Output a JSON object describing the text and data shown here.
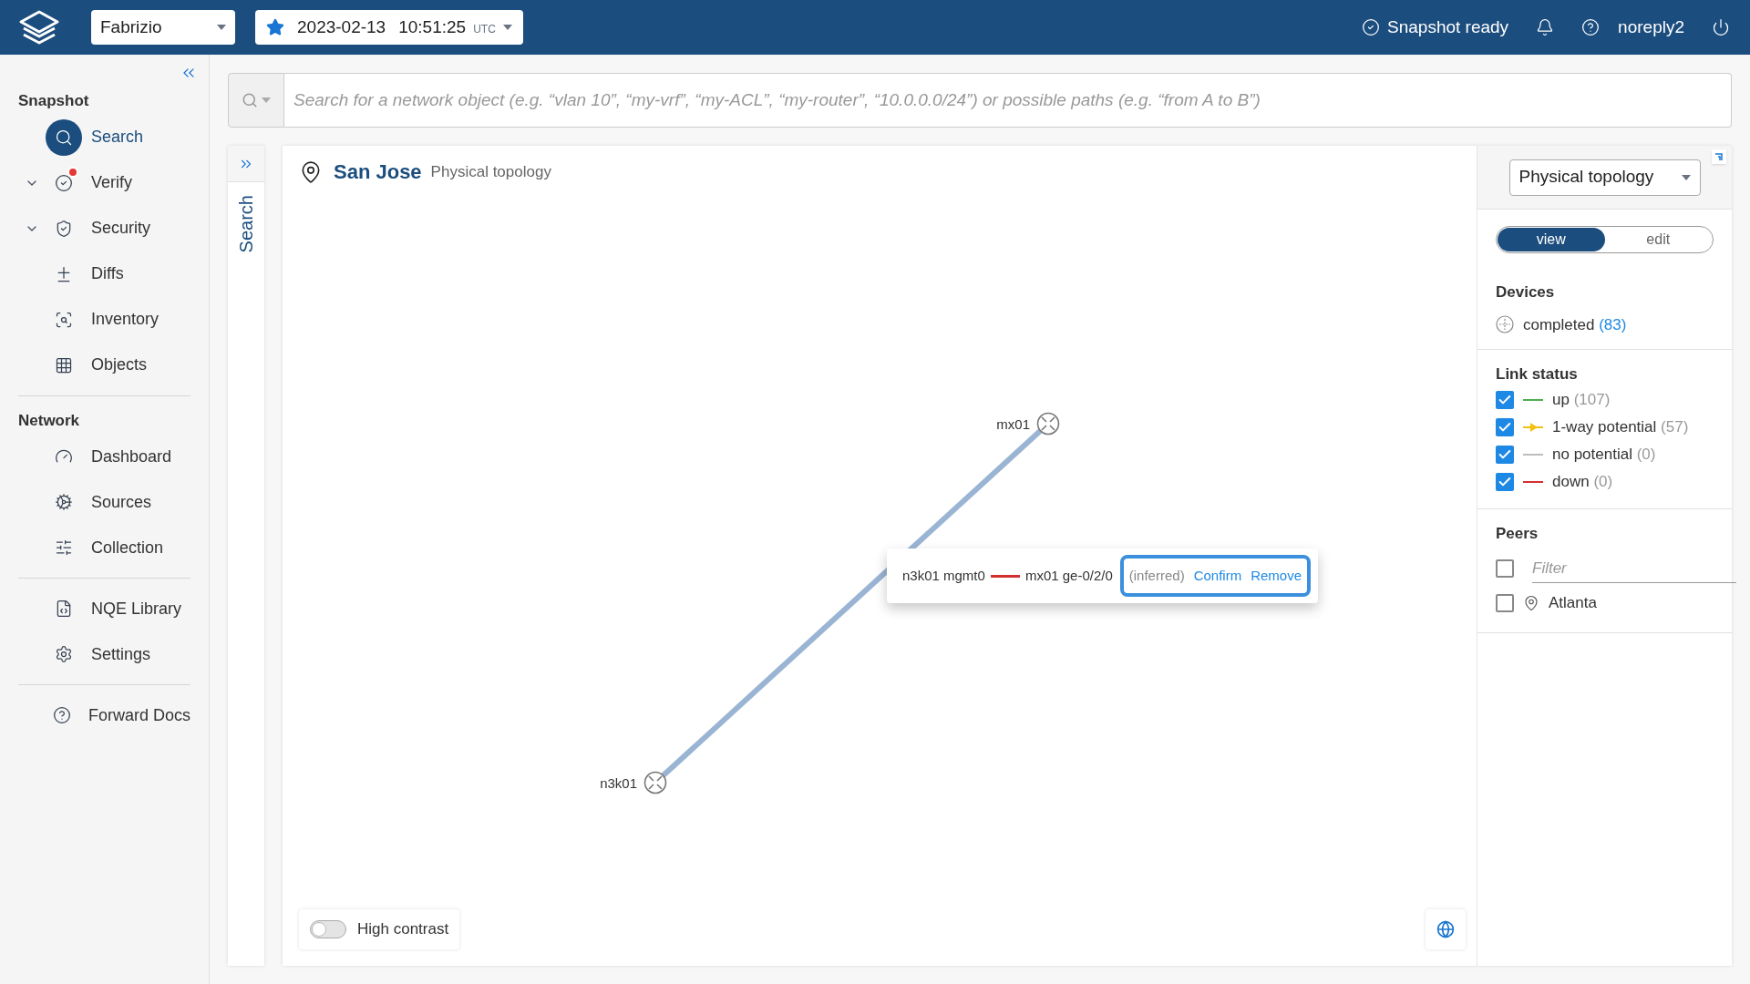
{
  "top_bar": {
    "user_select": "Fabrizio",
    "snapshot": {
      "starred": true,
      "date": "2023-02-13",
      "time": "10:51:25",
      "tz": "UTC"
    },
    "status": "Snapshot ready",
    "username": "noreply2"
  },
  "sidebar": {
    "sections": [
      {
        "title": "Snapshot",
        "items": [
          {
            "label": "Search",
            "selected": true,
            "expandable": false,
            "alert": false
          },
          {
            "label": "Verify",
            "selected": false,
            "expandable": true,
            "alert": true
          },
          {
            "label": "Security",
            "selected": false,
            "expandable": true,
            "alert": false
          },
          {
            "label": "Diffs",
            "selected": false,
            "expandable": false,
            "alert": false
          },
          {
            "label": "Inventory",
            "selected": false,
            "expandable": false,
            "alert": false
          },
          {
            "label": "Objects",
            "selected": false,
            "expandable": false,
            "alert": false
          }
        ]
      },
      {
        "title": "Network",
        "items": [
          {
            "label": "Dashboard",
            "selected": false,
            "expandable": false,
            "alert": false
          },
          {
            "label": "Sources",
            "selected": false,
            "expandable": false,
            "alert": false
          },
          {
            "label": "Collection",
            "selected": false,
            "expandable": false,
            "alert": false
          }
        ]
      },
      {
        "items": [
          {
            "label": "NQE Library",
            "selected": false,
            "expandable": false,
            "alert": false
          },
          {
            "label": "Settings",
            "selected": false,
            "expandable": false,
            "alert": false
          }
        ]
      },
      {
        "items": [
          {
            "label": "Forward Docs",
            "selected": false,
            "expandable": false,
            "alert": false
          }
        ]
      }
    ]
  },
  "search": {
    "placeholder": "Search for a network object (e.g. “vlan 10”, “my-vrf”, “my-ACL”, “my-router”, “10.0.0.0/24”) or possible paths (e.g. “from A to B”)"
  },
  "side_tab": {
    "label": "Search"
  },
  "topology": {
    "location": "San Jose",
    "subtitle": "Physical topology",
    "nodes": [
      {
        "name": "mx01"
      },
      {
        "name": "n3k01"
      }
    ],
    "tooltip": {
      "from": "n3k01 mgmt0",
      "to": "mx01 ge-0/2/0",
      "note": "(inferred)",
      "actions": [
        "Confirm",
        "Remove"
      ]
    },
    "high_contrast": {
      "label": "High contrast",
      "on": false
    }
  },
  "panel": {
    "view_select": "Physical topology",
    "modes": [
      {
        "label": "view",
        "selected": true
      },
      {
        "label": "edit",
        "selected": false
      }
    ],
    "devices": {
      "title": "Devices",
      "label": "completed",
      "count": "(83)"
    },
    "link_status": {
      "title": "Link status",
      "items": [
        {
          "label": "up",
          "count": "(107)",
          "checked": true,
          "color": "#4caf50",
          "kind": "line"
        },
        {
          "label": "1-way potential",
          "count": "(57)",
          "checked": true,
          "color": "#f4c20d",
          "kind": "arrow"
        },
        {
          "label": "no potential",
          "count": "(0)",
          "checked": true,
          "color": "#bdbdbd",
          "kind": "line"
        },
        {
          "label": "down",
          "count": "(0)",
          "checked": true,
          "color": "#d32f2f",
          "kind": "line"
        }
      ]
    },
    "peers": {
      "title": "Peers",
      "filter_placeholder": "Filter",
      "filter_checked": false,
      "items": [
        {
          "label": "Atlanta",
          "checked": false
        }
      ]
    }
  }
}
